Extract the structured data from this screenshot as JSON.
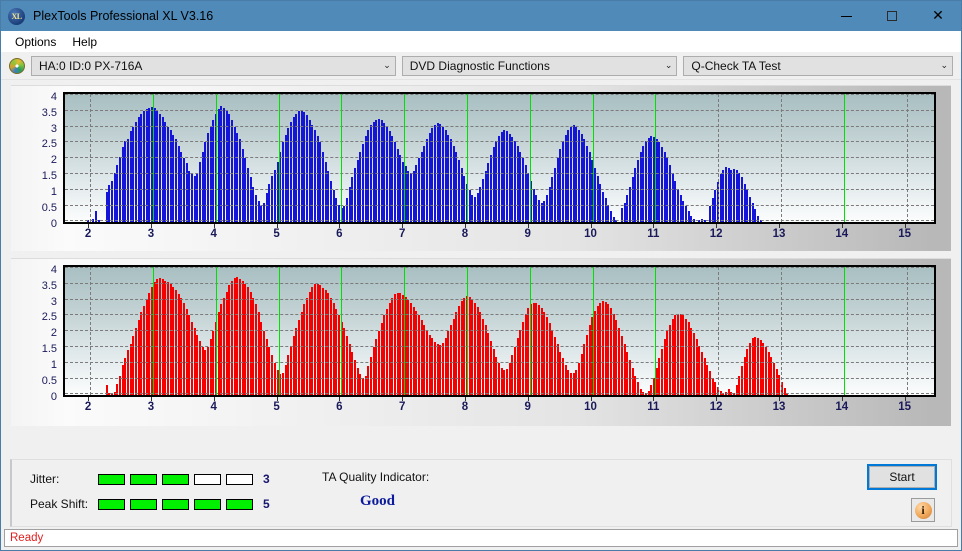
{
  "window": {
    "title": "PlexTools Professional XL V3.16",
    "icon": "XL",
    "minimize_label": "Minimize",
    "maximize_label": "Maximize",
    "close_label": "Close"
  },
  "menu": {
    "items": [
      {
        "label": "Options"
      },
      {
        "label": "Help"
      }
    ]
  },
  "toolbar": {
    "drive_icon": "disc-icon",
    "drive_select": {
      "value": "HA:0 ID:0  PX-716A",
      "chevron": "⌄"
    },
    "function_select": {
      "value": "DVD Diagnostic Functions",
      "chevron": "⌄"
    },
    "test_select": {
      "value": "Q-Check TA Test",
      "chevron": "⌄"
    }
  },
  "bottom": {
    "jitter_label": "Jitter:",
    "jitter_value": "3",
    "jitter_segments": [
      true,
      true,
      true,
      false,
      false
    ],
    "peak_shift_label": "Peak Shift:",
    "peak_shift_value": "5",
    "peak_shift_segments": [
      true,
      true,
      true,
      true,
      true
    ],
    "ta_title": "TA Quality Indicator:",
    "ta_value": "Good",
    "ta_value_color": "#0c1a9c",
    "start_label": "Start",
    "info_label": "i"
  },
  "statusbar": {
    "text": "Ready",
    "color": "#e02020"
  },
  "chart_data": [
    {
      "type": "bar",
      "title": "TA Test - Jitter (top plot)",
      "series_name": "jitter",
      "color": "#1515d8",
      "xlabel": "",
      "ylabel": "",
      "xlim": [
        1.6,
        15.5
      ],
      "ylim": [
        0,
        4.15
      ],
      "yticks": [
        0,
        0.5,
        1,
        1.5,
        2,
        2.5,
        3,
        3.5,
        4
      ],
      "ytick_labels": [
        "0",
        "0.5",
        "1",
        "1.5",
        "2",
        "2.5",
        "3",
        "3.5",
        "4"
      ],
      "xticks": [
        2,
        3,
        4,
        5,
        6,
        7,
        8,
        9,
        10,
        11,
        12,
        13,
        14,
        15
      ],
      "xtick_labels": [
        "2",
        "3",
        "4",
        "5",
        "6",
        "7",
        "8",
        "9",
        "10",
        "11",
        "12",
        "13",
        "14",
        "15"
      ],
      "grid": true,
      "markers": [
        3,
        4,
        5,
        6,
        7,
        8,
        9,
        10,
        11,
        14
      ],
      "marker_color": "#00e000",
      "bar_step": 0.0425,
      "x_start": 1.95,
      "values": [
        0.05,
        0,
        0.1,
        0.35,
        0.05,
        0,
        0,
        0.95,
        1.15,
        1.3,
        1.55,
        1.8,
        2.05,
        2.35,
        2.55,
        2.6,
        2.85,
        3.0,
        3.15,
        3.3,
        3.4,
        3.5,
        3.55,
        3.6,
        3.62,
        3.6,
        3.5,
        3.4,
        3.3,
        3.15,
        3.0,
        2.9,
        2.75,
        2.6,
        2.4,
        2.2,
        2.0,
        1.85,
        1.6,
        1.5,
        1.45,
        1.5,
        1.9,
        2.2,
        2.5,
        2.8,
        3.0,
        3.2,
        3.4,
        3.55,
        3.65,
        3.6,
        3.5,
        3.4,
        3.2,
        3.0,
        2.8,
        2.6,
        2.3,
        2.0,
        1.7,
        1.4,
        1.1,
        0.85,
        0.65,
        0.5,
        0.6,
        0.9,
        1.2,
        1.45,
        1.65,
        1.9,
        2.2,
        2.5,
        2.75,
        2.95,
        3.15,
        3.3,
        3.4,
        3.48,
        3.5,
        3.45,
        3.35,
        3.2,
        3.05,
        2.9,
        2.7,
        2.5,
        2.2,
        1.9,
        1.6,
        1.3,
        1.0,
        0.75,
        0.55,
        0.45,
        0.5,
        0.75,
        1.1,
        1.4,
        1.7,
        1.95,
        2.2,
        2.45,
        2.7,
        2.9,
        3.05,
        3.15,
        3.22,
        3.25,
        3.2,
        3.1,
        3.0,
        2.85,
        2.7,
        2.5,
        2.3,
        2.1,
        1.9,
        1.75,
        1.6,
        1.55,
        1.6,
        1.8,
        2.0,
        2.2,
        2.4,
        2.6,
        2.8,
        2.95,
        3.05,
        3.1,
        3.08,
        3.0,
        2.9,
        2.75,
        2.6,
        2.4,
        2.2,
        1.95,
        1.7,
        1.45,
        1.2,
        1.0,
        0.85,
        0.8,
        0.9,
        1.1,
        1.35,
        1.6,
        1.85,
        2.1,
        2.35,
        2.55,
        2.7,
        2.82,
        2.88,
        2.85,
        2.78,
        2.68,
        2.55,
        2.4,
        2.2,
        2.0,
        1.8,
        1.55,
        1.3,
        1.05,
        0.85,
        0.7,
        0.6,
        0.65,
        0.85,
        1.1,
        1.4,
        1.7,
        2.0,
        2.3,
        2.55,
        2.75,
        2.9,
        3.0,
        3.05,
        3.0,
        2.9,
        2.78,
        2.6,
        2.4,
        2.2,
        1.95,
        1.7,
        1.45,
        1.2,
        0.95,
        0.75,
        0.55,
        0.35,
        0.15,
        0.05,
        0,
        0.45,
        0.6,
        0.85,
        1.1,
        1.4,
        1.7,
        1.95,
        2.2,
        2.4,
        2.55,
        2.65,
        2.7,
        2.68,
        2.6,
        2.5,
        2.35,
        2.2,
        2.0,
        1.8,
        1.55,
        1.3,
        1.05,
        0.85,
        0.65,
        0.5,
        0.35,
        0.2,
        0.1,
        0,
        0.05,
        0.1,
        0.05,
        0,
        0.5,
        0.75,
        1.0,
        1.25,
        1.5,
        1.65,
        1.72,
        1.7,
        1.62,
        1.68,
        1.65,
        1.55,
        1.4,
        1.2,
        1.0,
        0.8,
        0.6,
        0.4,
        0.2,
        0.05,
        0,
        0,
        0,
        0,
        0,
        0,
        0,
        0,
        0,
        0,
        0,
        0,
        0,
        0,
        0,
        0,
        0,
        0,
        0,
        0,
        0,
        0,
        0,
        0,
        0,
        0,
        0,
        0,
        0,
        0,
        0,
        0,
        0,
        0,
        0,
        0,
        0,
        0,
        0,
        0,
        0,
        0,
        0,
        0,
        0,
        0,
        0,
        0,
        0,
        0,
        0,
        0,
        0,
        0,
        0,
        0,
        0,
        0,
        0,
        0,
        0,
        0,
        0,
        0,
        0,
        0,
        0,
        0,
        0,
        0,
        0,
        0,
        0,
        0,
        0,
        0,
        0,
        0,
        0,
        0,
        0,
        0,
        0.85,
        1.0,
        1.15,
        1.25,
        1.18,
        1.1,
        1.05,
        1.2,
        0.95,
        0.8,
        0.1,
        0.05,
        0.12,
        0,
        0,
        0,
        0,
        0,
        0,
        0,
        0,
        0,
        0,
        0,
        0,
        0,
        0,
        0,
        0,
        0,
        0,
        0,
        0,
        0,
        0,
        0,
        0,
        0,
        0,
        0,
        0,
        0,
        0,
        0,
        0,
        0,
        0
      ]
    },
    {
      "type": "bar",
      "title": "TA Test - Peak Shift (bottom plot)",
      "series_name": "peak_shift",
      "color": "#f40000",
      "xlabel": "",
      "ylabel": "",
      "xlim": [
        1.6,
        15.5
      ],
      "ylim": [
        0,
        4.15
      ],
      "yticks": [
        0,
        0.5,
        1,
        1.5,
        2,
        2.5,
        3,
        3.5,
        4
      ],
      "ytick_labels": [
        "0",
        "0.5",
        "1",
        "1.5",
        "2",
        "2.5",
        "3",
        "3.5",
        "4"
      ],
      "xticks": [
        2,
        3,
        4,
        5,
        6,
        7,
        8,
        9,
        10,
        11,
        12,
        13,
        14,
        15
      ],
      "xtick_labels": [
        "2",
        "3",
        "4",
        "5",
        "6",
        "7",
        "8",
        "9",
        "10",
        "11",
        "12",
        "13",
        "14",
        "15"
      ],
      "grid": true,
      "markers": [
        3,
        4,
        5,
        6,
        7,
        8,
        9,
        10,
        11,
        14
      ],
      "marker_color": "#00e000",
      "bar_step": 0.0425,
      "x_start": 1.95,
      "values": [
        0,
        0,
        0,
        0,
        0,
        0,
        0,
        0.33,
        0.05,
        0.05,
        0.1,
        0.35,
        0.6,
        0.95,
        1.15,
        1.4,
        1.6,
        1.85,
        2.1,
        2.35,
        2.6,
        2.8,
        3.0,
        3.2,
        3.4,
        3.55,
        3.65,
        3.68,
        3.66,
        3.6,
        3.55,
        3.48,
        3.4,
        3.3,
        3.18,
        3.05,
        2.9,
        2.7,
        2.5,
        2.3,
        2.1,
        1.9,
        1.7,
        1.5,
        1.42,
        1.5,
        1.75,
        2.0,
        2.3,
        2.6,
        2.85,
        3.05,
        3.25,
        3.45,
        3.6,
        3.68,
        3.7,
        3.65,
        3.58,
        3.5,
        3.4,
        3.25,
        3.05,
        2.85,
        2.6,
        2.3,
        2.0,
        1.75,
        1.5,
        1.25,
        1.0,
        0.8,
        0.65,
        0.7,
        0.95,
        1.25,
        1.55,
        1.85,
        2.1,
        2.35,
        2.6,
        2.85,
        3.05,
        3.25,
        3.4,
        3.48,
        3.5,
        3.45,
        3.38,
        3.3,
        3.2,
        3.05,
        2.9,
        2.7,
        2.5,
        2.3,
        2.1,
        1.85,
        1.6,
        1.35,
        1.1,
        0.85,
        0.65,
        0.52,
        0.6,
        0.9,
        1.2,
        1.5,
        1.75,
        2.0,
        2.25,
        2.5,
        2.7,
        2.9,
        3.05,
        3.18,
        3.22,
        3.2,
        3.15,
        3.08,
        3.0,
        2.9,
        2.78,
        2.65,
        2.5,
        2.35,
        2.2,
        2.05,
        1.9,
        1.78,
        1.68,
        1.6,
        1.58,
        1.62,
        1.8,
        2.0,
        2.2,
        2.4,
        2.6,
        2.8,
        2.95,
        3.05,
        3.1,
        3.08,
        3.0,
        2.9,
        2.78,
        2.6,
        2.4,
        2.2,
        1.95,
        1.7,
        1.45,
        1.2,
        1.0,
        0.85,
        0.78,
        0.82,
        1.0,
        1.25,
        1.5,
        1.78,
        2.05,
        2.3,
        2.55,
        2.72,
        2.85,
        2.9,
        2.88,
        2.82,
        2.72,
        2.6,
        2.45,
        2.25,
        2.05,
        1.82,
        1.6,
        1.35,
        1.15,
        0.95,
        0.8,
        0.7,
        0.68,
        0.8,
        1.0,
        1.3,
        1.6,
        1.9,
        2.2,
        2.45,
        2.65,
        2.8,
        2.9,
        2.95,
        2.92,
        2.85,
        2.72,
        2.55,
        2.35,
        2.1,
        1.85,
        1.6,
        1.35,
        1.1,
        0.85,
        0.6,
        0.4,
        0.2,
        0.1,
        0.05,
        0.12,
        0.3,
        0.55,
        0.85,
        1.15,
        1.45,
        1.75,
        2.0,
        2.2,
        2.38,
        2.5,
        2.56,
        2.55,
        2.5,
        2.4,
        2.28,
        2.12,
        1.95,
        1.75,
        1.55,
        1.35,
        1.15,
        0.95,
        0.75,
        0.55,
        0.4,
        0.25,
        0.12,
        0.05,
        0.1,
        0.2,
        0.1,
        0.05,
        0.3,
        0.6,
        0.9,
        1.2,
        1.45,
        1.65,
        1.78,
        1.82,
        1.8,
        1.72,
        1.62,
        1.5,
        1.35,
        1.18,
        1.0,
        0.82,
        0.62,
        0.42,
        0.22,
        0.05,
        0,
        0,
        0,
        0,
        0,
        0,
        0,
        0,
        0,
        0,
        0,
        0,
        0,
        0,
        0,
        0,
        0,
        0,
        0,
        0,
        0,
        0,
        0,
        0,
        0,
        0,
        0,
        0,
        0,
        0,
        0,
        0,
        0,
        0,
        0,
        0,
        0,
        0,
        0,
        0,
        0,
        0,
        0,
        0,
        0,
        0,
        0,
        0,
        0,
        0,
        0,
        0,
        0,
        0,
        0,
        0,
        0,
        0,
        0,
        0,
        0,
        0,
        0,
        0,
        0,
        0,
        0,
        0,
        0,
        0,
        0,
        0,
        0,
        0,
        0,
        0,
        0,
        0,
        0,
        0,
        0,
        0,
        1.0,
        1.4,
        1.75,
        2.0,
        2.12,
        2.18,
        2.15,
        2.1,
        2.05,
        2.05,
        1.8,
        1.5,
        1.2,
        0.9,
        0.6,
        0.35,
        0.15,
        0.05,
        0,
        0,
        0,
        0,
        0,
        0,
        0,
        0,
        0,
        0,
        0,
        0,
        0,
        0,
        0,
        0,
        0,
        0,
        0,
        0,
        0,
        0,
        0
      ]
    }
  ]
}
